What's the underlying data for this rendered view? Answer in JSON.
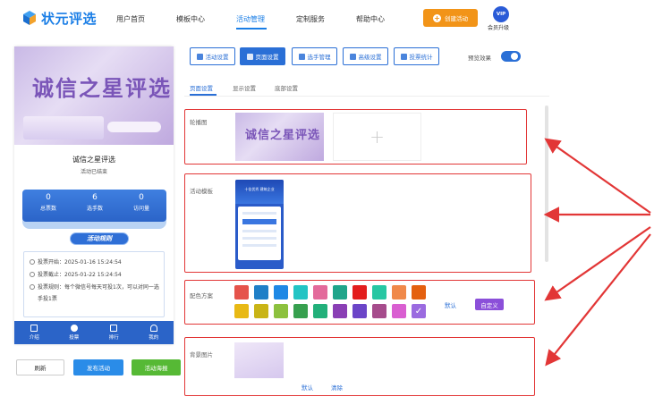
{
  "brand": {
    "name": "状元评选"
  },
  "nav": {
    "items": [
      {
        "label": "用户首页"
      },
      {
        "label": "模板中心"
      },
      {
        "label": "活动管理"
      },
      {
        "label": "定制服务"
      },
      {
        "label": "帮助中心"
      }
    ],
    "active_index": 2,
    "create_button": "创建活动",
    "vip_badge": "VIP",
    "vip_label": "会员升级"
  },
  "preview": {
    "banner_title": "诚信之星评选",
    "title": "诚信之星评选",
    "status": "活动已结束",
    "stats": [
      {
        "value": "0",
        "label": "总票数"
      },
      {
        "value": "6",
        "label": "选手数"
      },
      {
        "value": "0",
        "label": "访问量"
      }
    ],
    "rules_button": "活动规则",
    "info": [
      "投票开始：2025-01-16 15:24:54",
      "投票截止：2025-01-22 15:24:54",
      "投票规则：每个微信号每天可投1次，可以对同一选",
      "手投1票"
    ],
    "tabs": [
      "介绍",
      "投票",
      "排行",
      "我的"
    ]
  },
  "actions": {
    "refresh": "刷新",
    "publish": "发布活动",
    "poster": "活动海报"
  },
  "toolbar": {
    "buttons": [
      "活动设置",
      "页面设置",
      "选手管理",
      "高级设置",
      "投票统计"
    ],
    "active_index": 1,
    "preview_label": "预览效果",
    "preview_on": true
  },
  "subtabs": {
    "items": [
      "页面设置",
      "显示设置",
      "底部设置"
    ],
    "active_index": 0
  },
  "sections": {
    "carousel": {
      "label": "轮播图",
      "image_title": "诚信之星评选",
      "add_symbol": "+"
    },
    "template": {
      "label": "活动模板",
      "thumb_line1": "十佳优秀 建筑企业"
    },
    "colors": {
      "label": "配色方案",
      "row1": [
        "#e5534b",
        "#1f7fc7",
        "#1e88e5",
        "#23c4c4",
        "#e36a9b",
        "#1fa58a",
        "#e31d1d",
        "#27c7a3",
        "#f0894a",
        "#e4600f"
      ],
      "row2": [
        "#e8b915",
        "#c9b416",
        "#8cc13e",
        "#37a04f",
        "#22b07a",
        "#8a3fb5",
        "#6b45c8",
        "#a64c8c",
        "#d95fd1",
        "#9b6be0"
      ],
      "selected": "row2-9",
      "default_link": "默认",
      "custom_button": "自定义"
    },
    "background": {
      "label": "背景图片",
      "default_link": "默认",
      "clear_link": "清除"
    }
  }
}
